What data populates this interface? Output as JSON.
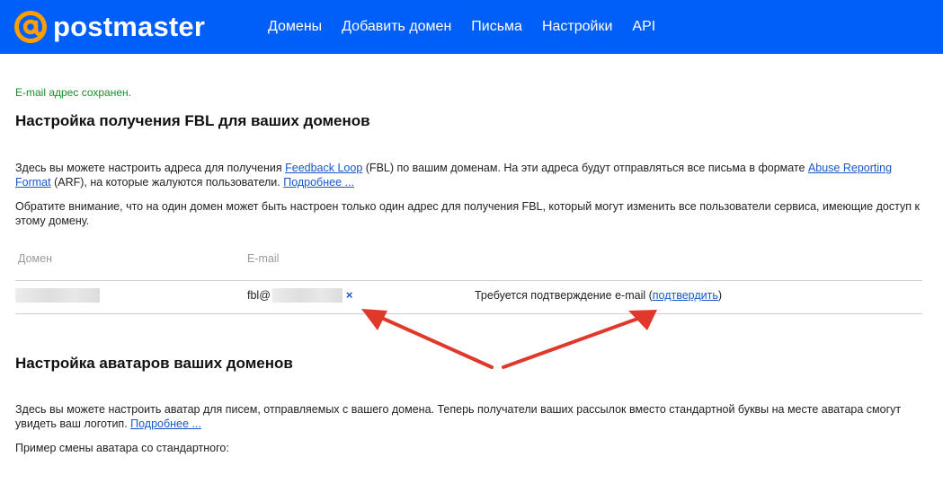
{
  "header": {
    "logo_text": "postmaster",
    "nav": [
      "Домены",
      "Добавить домен",
      "Письма",
      "Настройки",
      "API"
    ],
    "bg_color": "#005ff9"
  },
  "status_message": "E-mail адрес сохранен.",
  "fbl_section": {
    "title": "Настройка получения FBL для ваших доменов",
    "intro_part1": "Здесь вы можете настроить адреса для получения ",
    "link_fbl": "Feedback Loop",
    "intro_part2": " (FBL) по вашим доменам. На эти адреса будут отправляться все письма в формате ",
    "link_arf": "Abuse Reporting Format",
    "intro_part3": " (ARF), на которые жалуются пользователи. ",
    "link_more": "Подробнее ...",
    "notice": "Обратите внимание, что на один домен может быть настроен только один адрес для получения FBL, который могут изменить все пользователи сервиса, имеющие доступ к этому домену."
  },
  "table": {
    "col_domain": "Домен",
    "col_email": "E-mail",
    "row": {
      "email_prefix": "fbl@",
      "delete_symbol": "×",
      "status_text": "Требуется подтверждение e-mail (",
      "confirm_link": "подтвердить",
      "status_close": ")"
    }
  },
  "avatar_section": {
    "title": "Настройка аватаров ваших доменов",
    "intro": "Здесь вы можете настроить аватар для писем, отправляемых с вашего домена. Теперь получатели ваших рассылок вместо стандартной буквы на месте аватара смогут увидеть ваш логотип. ",
    "link_more": "Подробнее ...",
    "example": "Пример смены аватара со стандартного:"
  },
  "colors": {
    "accent_link": "#1a56c8",
    "success": "#1b8b2a",
    "annotation_arrow": "#e0392b"
  }
}
